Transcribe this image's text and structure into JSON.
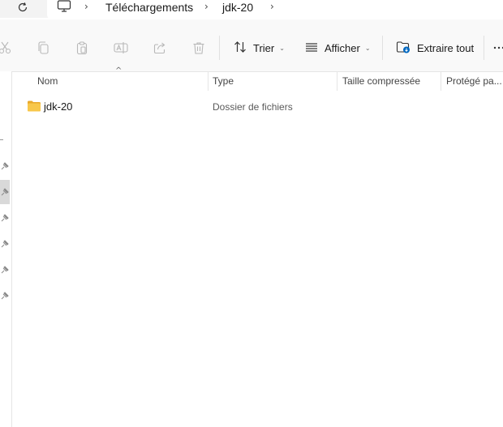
{
  "address_bar": {
    "refresh_icon": "refresh-icon",
    "pc_icon": "computer-icon",
    "breadcrumbs": [
      "Téléchargements",
      "jdk-20"
    ]
  },
  "toolbar": {
    "cut_icon": "cut-icon",
    "copy_icon": "copy-icon",
    "paste_icon": "paste-icon",
    "rename_icon": "rename-icon",
    "share_icon": "share-icon",
    "delete_icon": "delete-icon",
    "sort_label": "Trier",
    "view_label": "Afficher",
    "extract_label": "Extraire tout",
    "more_icon": "more-icon"
  },
  "columns": {
    "name": "Nom",
    "type": "Type",
    "compressed_size": "Taille compressée",
    "protected": "Protégé pa..."
  },
  "files": [
    {
      "name": "jdk-20",
      "type": "Dossier de fichiers",
      "icon": "folder-icon"
    }
  ],
  "colors": {
    "folder_yellow": "#f8c74a",
    "accent_blue": "#0067c0"
  }
}
